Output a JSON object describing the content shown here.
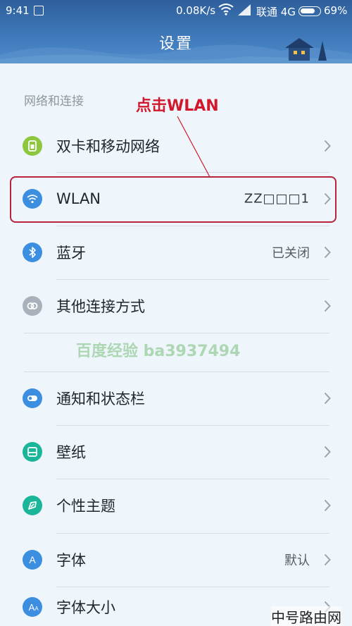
{
  "status_bar": {
    "time": "9:41",
    "speed": "0.08K/s",
    "carrier": "联通 4G",
    "battery": "69%"
  },
  "header": {
    "title": "设置"
  },
  "section": {
    "label": "网络和连接"
  },
  "annotation": {
    "text": "点击WLAN"
  },
  "rows": [
    {
      "label": "双卡和移动网络",
      "value": "",
      "icon": "sim-card-icon",
      "color": "#8dc63f"
    },
    {
      "label": "WLAN",
      "value": "ZZ□□□1",
      "icon": "wifi-icon",
      "color": "#3b8ee0"
    },
    {
      "label": "蓝牙",
      "value": "已关闭",
      "icon": "bluetooth-icon",
      "color": "#3b8ee0"
    },
    {
      "label": "其他连接方式",
      "value": "",
      "icon": "link-icon",
      "color": "#a9b2ba"
    },
    {
      "label": "通知和状态栏",
      "value": "",
      "icon": "notification-icon",
      "color": "#3b8ee0"
    },
    {
      "label": "壁纸",
      "value": "",
      "icon": "wallpaper-icon",
      "color": "#1bb59a"
    },
    {
      "label": "个性主题",
      "value": "",
      "icon": "theme-icon",
      "color": "#1bb59a"
    },
    {
      "label": "字体",
      "value": "默认",
      "icon": "font-icon",
      "color": "#3b8ee0"
    },
    {
      "label": "字体大小",
      "value": "",
      "icon": "font-size-icon",
      "color": "#3b8ee0"
    }
  ],
  "watermarks": {
    "baidu_jingyan": "百度经验 ba3937494",
    "corner": "中号路由网"
  }
}
